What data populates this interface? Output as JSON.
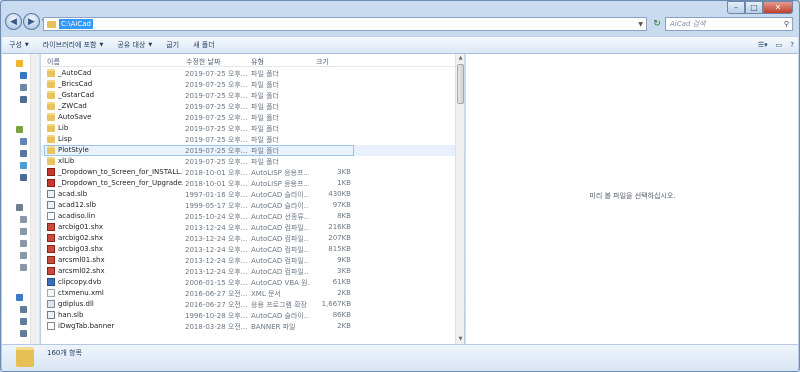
{
  "address": {
    "path": "C:\\AiCad"
  },
  "search": {
    "placeholder": "AiCad 검색"
  },
  "toolbar": {
    "organize": "구성",
    "include_library": "라이브러리에 포함",
    "share": "공유 대상",
    "burn": "굽기",
    "new_folder": "새 폴더"
  },
  "columns": {
    "name": "이름",
    "date": "수정한 날짜",
    "type": "유형",
    "size": "크기"
  },
  "files": [
    {
      "icon": "folder",
      "name": "_AutoCad",
      "date": "2019-07-25 오후...",
      "type": "파일 폴더",
      "size": ""
    },
    {
      "icon": "folder",
      "name": "_BricsCad",
      "date": "2019-07-25 오후...",
      "type": "파일 폴더",
      "size": ""
    },
    {
      "icon": "folder",
      "name": "_GstarCad",
      "date": "2019-07-25 오후...",
      "type": "파일 폴더",
      "size": ""
    },
    {
      "icon": "folder",
      "name": "_ZWCad",
      "date": "2019-07-25 오후...",
      "type": "파일 폴더",
      "size": ""
    },
    {
      "icon": "folder",
      "name": "AutoSave",
      "date": "2019-07-25 오후...",
      "type": "파일 폴더",
      "size": ""
    },
    {
      "icon": "folder",
      "name": "Lib",
      "date": "2019-07-25 오후...",
      "type": "파일 폴더",
      "size": ""
    },
    {
      "icon": "folder",
      "name": "Lisp",
      "date": "2019-07-25 오후...",
      "type": "파일 폴더",
      "size": ""
    },
    {
      "icon": "folder",
      "name": "PlotStyle",
      "date": "2019-07-25 오후...",
      "type": "파일 폴더",
      "size": ""
    },
    {
      "icon": "folder",
      "name": "xlLib",
      "date": "2019-07-25 오후...",
      "type": "파일 폴더",
      "size": ""
    },
    {
      "icon": "lsp",
      "name": "_Dropdown_to_Screen_for_INSTALL.lsp",
      "date": "2018-10-01 오후...",
      "type": "AutoLISP 응용프...",
      "size": "3KB"
    },
    {
      "icon": "lsp",
      "name": "_Dropdown_to_Screen_for_Upgrade.lsp",
      "date": "2018-10-01 오후...",
      "type": "AutoLISP 응용프...",
      "size": "1KB"
    },
    {
      "icon": "slb",
      "name": "acad.slb",
      "date": "1997-01-16 오후...",
      "type": "AutoCAD 슬라이...",
      "size": "430KB"
    },
    {
      "icon": "slb",
      "name": "acad12.slb",
      "date": "1999-05-17 오후...",
      "type": "AutoCAD 슬라이...",
      "size": "97KB"
    },
    {
      "icon": "file",
      "name": "acadiso.lin",
      "date": "2015-10-24 오후...",
      "type": "AutoCAD 선종류...",
      "size": "8KB"
    },
    {
      "icon": "shx",
      "name": "arcbig01.shx",
      "date": "2013-12-24 오후...",
      "type": "AutoCAD 컴파일...",
      "size": "216KB"
    },
    {
      "icon": "shx",
      "name": "arcbig02.shx",
      "date": "2013-12-24 오후...",
      "type": "AutoCAD 컴파일...",
      "size": "207KB"
    },
    {
      "icon": "shx",
      "name": "arcbig03.shx",
      "date": "2013-12-24 오후...",
      "type": "AutoCAD 컴파일...",
      "size": "815KB"
    },
    {
      "icon": "shx",
      "name": "arcsml01.shx",
      "date": "2013-12-24 오후...",
      "type": "AutoCAD 컴파일...",
      "size": "9KB"
    },
    {
      "icon": "shx",
      "name": "arcsml02.shx",
      "date": "2013-12-24 오후...",
      "type": "AutoCAD 컴파일...",
      "size": "3KB"
    },
    {
      "icon": "dvb",
      "name": "clipcopy.dvb",
      "date": "2006-01-15 오후...",
      "type": "AutoCAD VBA 원...",
      "size": "61KB"
    },
    {
      "icon": "xml",
      "name": "ctxmenu.xml",
      "date": "2016-06-27 오전...",
      "type": "XML 문서",
      "size": "2KB"
    },
    {
      "icon": "dll",
      "name": "gdiplus.dll",
      "date": "2016-06-27 오전...",
      "type": "응용 프로그램 확장",
      "size": "1,667KB"
    },
    {
      "icon": "slb",
      "name": "han.slb",
      "date": "1996-10-28 오후...",
      "type": "AutoCAD 슬라이...",
      "size": "86KB"
    },
    {
      "icon": "file",
      "name": "iDwgTab.banner",
      "date": "2018-03-28 오전...",
      "type": "BANNER 파일",
      "size": "2KB"
    }
  ],
  "preview": {
    "message": "미리 볼 파일을 선택하십시오."
  },
  "details": {
    "count": "160개 항목"
  },
  "colors": {
    "selection": "#e8f1fb",
    "accent": "#3399ff",
    "folder": "#e9c35c"
  }
}
